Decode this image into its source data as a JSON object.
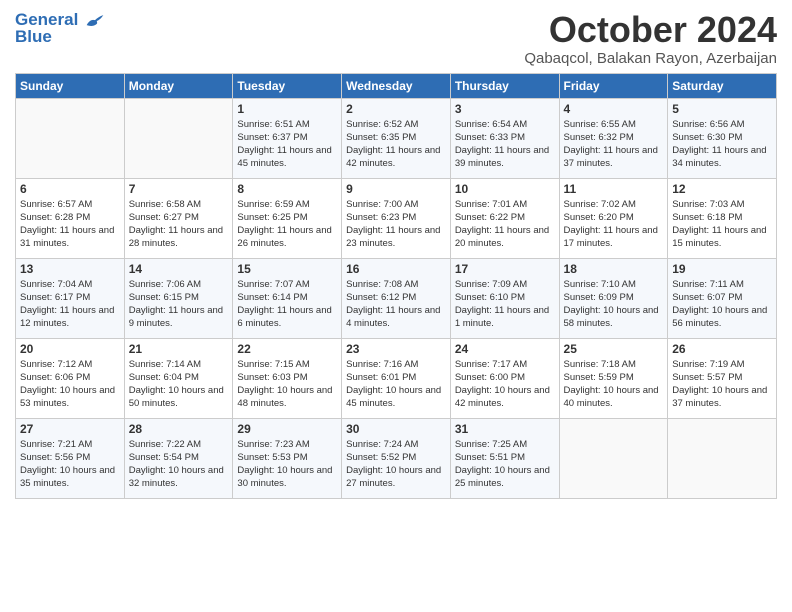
{
  "logo": {
    "line1": "General",
    "line2": "Blue"
  },
  "title": "October 2024",
  "subtitle": "Qabaqcol, Balakan Rayon, Azerbaijan",
  "days_of_week": [
    "Sunday",
    "Monday",
    "Tuesday",
    "Wednesday",
    "Thursday",
    "Friday",
    "Saturday"
  ],
  "weeks": [
    [
      {
        "day": "",
        "sunrise": "",
        "sunset": "",
        "daylight": ""
      },
      {
        "day": "",
        "sunrise": "",
        "sunset": "",
        "daylight": ""
      },
      {
        "day": "1",
        "sunrise": "Sunrise: 6:51 AM",
        "sunset": "Sunset: 6:37 PM",
        "daylight": "Daylight: 11 hours and 45 minutes."
      },
      {
        "day": "2",
        "sunrise": "Sunrise: 6:52 AM",
        "sunset": "Sunset: 6:35 PM",
        "daylight": "Daylight: 11 hours and 42 minutes."
      },
      {
        "day": "3",
        "sunrise": "Sunrise: 6:54 AM",
        "sunset": "Sunset: 6:33 PM",
        "daylight": "Daylight: 11 hours and 39 minutes."
      },
      {
        "day": "4",
        "sunrise": "Sunrise: 6:55 AM",
        "sunset": "Sunset: 6:32 PM",
        "daylight": "Daylight: 11 hours and 37 minutes."
      },
      {
        "day": "5",
        "sunrise": "Sunrise: 6:56 AM",
        "sunset": "Sunset: 6:30 PM",
        "daylight": "Daylight: 11 hours and 34 minutes."
      }
    ],
    [
      {
        "day": "6",
        "sunrise": "Sunrise: 6:57 AM",
        "sunset": "Sunset: 6:28 PM",
        "daylight": "Daylight: 11 hours and 31 minutes."
      },
      {
        "day": "7",
        "sunrise": "Sunrise: 6:58 AM",
        "sunset": "Sunset: 6:27 PM",
        "daylight": "Daylight: 11 hours and 28 minutes."
      },
      {
        "day": "8",
        "sunrise": "Sunrise: 6:59 AM",
        "sunset": "Sunset: 6:25 PM",
        "daylight": "Daylight: 11 hours and 26 minutes."
      },
      {
        "day": "9",
        "sunrise": "Sunrise: 7:00 AM",
        "sunset": "Sunset: 6:23 PM",
        "daylight": "Daylight: 11 hours and 23 minutes."
      },
      {
        "day": "10",
        "sunrise": "Sunrise: 7:01 AM",
        "sunset": "Sunset: 6:22 PM",
        "daylight": "Daylight: 11 hours and 20 minutes."
      },
      {
        "day": "11",
        "sunrise": "Sunrise: 7:02 AM",
        "sunset": "Sunset: 6:20 PM",
        "daylight": "Daylight: 11 hours and 17 minutes."
      },
      {
        "day": "12",
        "sunrise": "Sunrise: 7:03 AM",
        "sunset": "Sunset: 6:18 PM",
        "daylight": "Daylight: 11 hours and 15 minutes."
      }
    ],
    [
      {
        "day": "13",
        "sunrise": "Sunrise: 7:04 AM",
        "sunset": "Sunset: 6:17 PM",
        "daylight": "Daylight: 11 hours and 12 minutes."
      },
      {
        "day": "14",
        "sunrise": "Sunrise: 7:06 AM",
        "sunset": "Sunset: 6:15 PM",
        "daylight": "Daylight: 11 hours and 9 minutes."
      },
      {
        "day": "15",
        "sunrise": "Sunrise: 7:07 AM",
        "sunset": "Sunset: 6:14 PM",
        "daylight": "Daylight: 11 hours and 6 minutes."
      },
      {
        "day": "16",
        "sunrise": "Sunrise: 7:08 AM",
        "sunset": "Sunset: 6:12 PM",
        "daylight": "Daylight: 11 hours and 4 minutes."
      },
      {
        "day": "17",
        "sunrise": "Sunrise: 7:09 AM",
        "sunset": "Sunset: 6:10 PM",
        "daylight": "Daylight: 11 hours and 1 minute."
      },
      {
        "day": "18",
        "sunrise": "Sunrise: 7:10 AM",
        "sunset": "Sunset: 6:09 PM",
        "daylight": "Daylight: 10 hours and 58 minutes."
      },
      {
        "day": "19",
        "sunrise": "Sunrise: 7:11 AM",
        "sunset": "Sunset: 6:07 PM",
        "daylight": "Daylight: 10 hours and 56 minutes."
      }
    ],
    [
      {
        "day": "20",
        "sunrise": "Sunrise: 7:12 AM",
        "sunset": "Sunset: 6:06 PM",
        "daylight": "Daylight: 10 hours and 53 minutes."
      },
      {
        "day": "21",
        "sunrise": "Sunrise: 7:14 AM",
        "sunset": "Sunset: 6:04 PM",
        "daylight": "Daylight: 10 hours and 50 minutes."
      },
      {
        "day": "22",
        "sunrise": "Sunrise: 7:15 AM",
        "sunset": "Sunset: 6:03 PM",
        "daylight": "Daylight: 10 hours and 48 minutes."
      },
      {
        "day": "23",
        "sunrise": "Sunrise: 7:16 AM",
        "sunset": "Sunset: 6:01 PM",
        "daylight": "Daylight: 10 hours and 45 minutes."
      },
      {
        "day": "24",
        "sunrise": "Sunrise: 7:17 AM",
        "sunset": "Sunset: 6:00 PM",
        "daylight": "Daylight: 10 hours and 42 minutes."
      },
      {
        "day": "25",
        "sunrise": "Sunrise: 7:18 AM",
        "sunset": "Sunset: 5:59 PM",
        "daylight": "Daylight: 10 hours and 40 minutes."
      },
      {
        "day": "26",
        "sunrise": "Sunrise: 7:19 AM",
        "sunset": "Sunset: 5:57 PM",
        "daylight": "Daylight: 10 hours and 37 minutes."
      }
    ],
    [
      {
        "day": "27",
        "sunrise": "Sunrise: 7:21 AM",
        "sunset": "Sunset: 5:56 PM",
        "daylight": "Daylight: 10 hours and 35 minutes."
      },
      {
        "day": "28",
        "sunrise": "Sunrise: 7:22 AM",
        "sunset": "Sunset: 5:54 PM",
        "daylight": "Daylight: 10 hours and 32 minutes."
      },
      {
        "day": "29",
        "sunrise": "Sunrise: 7:23 AM",
        "sunset": "Sunset: 5:53 PM",
        "daylight": "Daylight: 10 hours and 30 minutes."
      },
      {
        "day": "30",
        "sunrise": "Sunrise: 7:24 AM",
        "sunset": "Sunset: 5:52 PM",
        "daylight": "Daylight: 10 hours and 27 minutes."
      },
      {
        "day": "31",
        "sunrise": "Sunrise: 7:25 AM",
        "sunset": "Sunset: 5:51 PM",
        "daylight": "Daylight: 10 hours and 25 minutes."
      },
      {
        "day": "",
        "sunrise": "",
        "sunset": "",
        "daylight": ""
      },
      {
        "day": "",
        "sunrise": "",
        "sunset": "",
        "daylight": ""
      }
    ]
  ]
}
